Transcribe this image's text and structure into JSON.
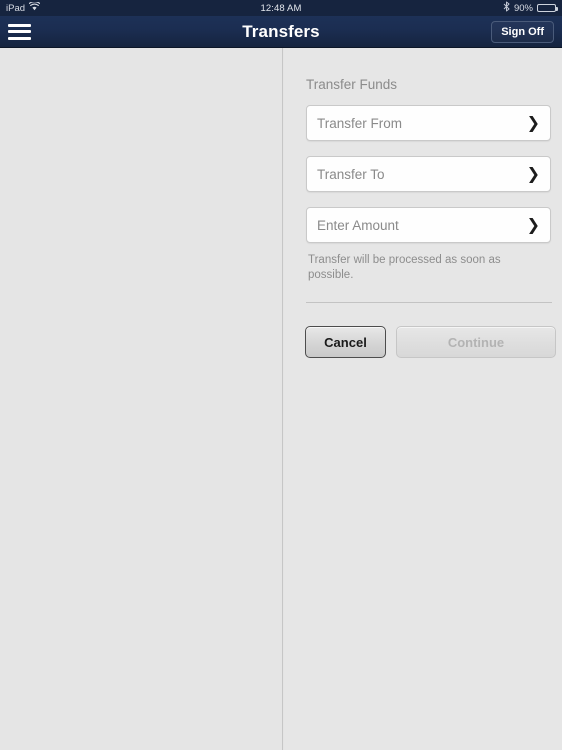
{
  "status_bar": {
    "device_label": "iPad",
    "wifi_icon": "wifi-icon",
    "time": "12:48 AM",
    "bluetooth_icon": "bluetooth-icon",
    "battery_percent": "90%",
    "battery_icon": "battery-icon",
    "battery_level": 90
  },
  "nav_bar": {
    "menu_icon": "hamburger-menu-icon",
    "title": "Transfers",
    "sign_off_label": "Sign Off",
    "background_color": "#1b2d51"
  },
  "main": {
    "section_title": "Transfer Funds",
    "fields": [
      {
        "label": "Transfer From",
        "value": "",
        "chevron": "chevron-right-icon"
      },
      {
        "label": "Transfer To",
        "value": "",
        "chevron": "chevron-right-icon"
      },
      {
        "label": "Enter Amount",
        "value": "",
        "chevron": "chevron-right-icon"
      }
    ],
    "helper_text": "Transfer will be processed as soon as possible.",
    "buttons": {
      "cancel_label": "Cancel",
      "continue_label": "Continue",
      "continue_disabled": true
    }
  },
  "colors": {
    "nav_navy": "#1b2d51",
    "page_background": "#e4e4e4",
    "field_background": "#fefefe",
    "muted_text": "#8b8b8b"
  }
}
